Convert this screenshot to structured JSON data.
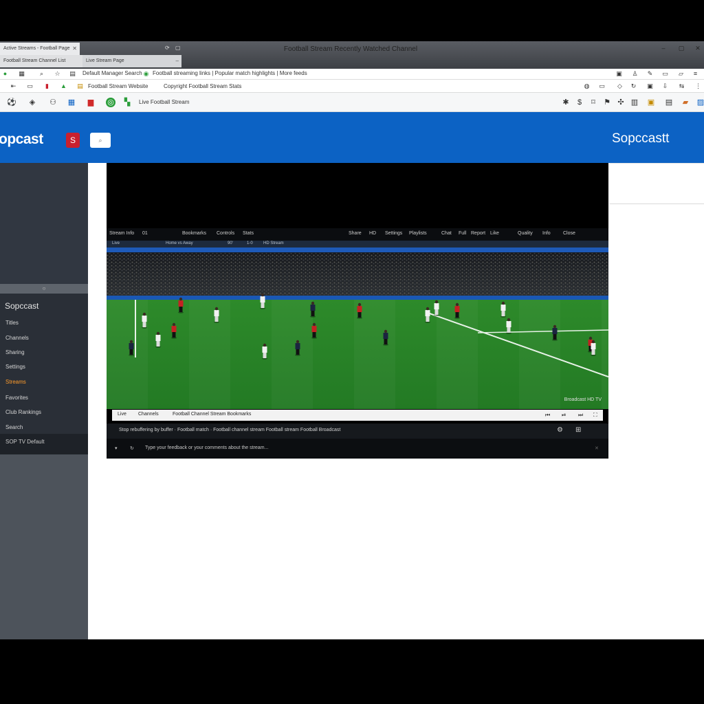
{
  "window": {
    "title": "Football Stream Recently Watched Channel",
    "tabs": [
      {
        "label": "Active Streams - Football Page"
      },
      {
        "label": "Football Stream Channel List"
      },
      {
        "label": "Live Stream Page"
      }
    ],
    "controls": {
      "minimize": "–",
      "restore": "▢",
      "close": "✕"
    }
  },
  "bookmarks": {
    "line1": "Default Manager Search",
    "line2": "Football streaming links | Popular match highlights | More feeds"
  },
  "address_bar": {
    "text1": "Football Stream Website",
    "text2": "Copyright Football Stream Stats"
  },
  "nav_bar": {
    "label": "Live Football Stream"
  },
  "site": {
    "brand_left": "opcast",
    "brand_right": "Sopccastt",
    "badge": "S",
    "search_icon": "⌕"
  },
  "sidebar": {
    "separator": "○",
    "title": "Sopccast",
    "items": [
      {
        "label": "Titles",
        "active": false
      },
      {
        "label": "Channels",
        "active": false
      },
      {
        "label": "Sharing",
        "active": false
      },
      {
        "label": "Settings",
        "active": false
      },
      {
        "label": "Streams",
        "active": true
      },
      {
        "label": "Favorites",
        "active": false
      },
      {
        "label": "Club Rankings",
        "active": false
      },
      {
        "label": "Search",
        "active": false
      }
    ],
    "footer": "SOP TV Default"
  },
  "player": {
    "toolbar_left": [
      "Stream Info",
      "01",
      "Bookmarks",
      "Controls",
      "Stats"
    ],
    "toolbar_right": [
      "Share",
      "HD",
      "Settings",
      "Playlists",
      "Chat",
      "Full",
      "Report",
      "Like",
      "Quality",
      "Info",
      "Close"
    ],
    "infobar": [
      "Live",
      "Home vs Away",
      "90'",
      "1-0",
      "HD Stream"
    ],
    "watermark": "Broadcast HD TV",
    "ctrl": {
      "left1": "Live",
      "left2": "Channels",
      "middle": "Football Channel Stream Bookmarks",
      "icons": [
        "⏮",
        "⏯",
        "⏭",
        "⛶"
      ]
    },
    "info_row": {
      "text": "Stop rebuffering by buffer · Football match · Football channel stream Football stream Football Broadcast",
      "icons": [
        "⚙",
        "⊞"
      ]
    },
    "chat": {
      "text": "Type your feedback or your comments about the stream...",
      "icons": [
        "▾",
        "↻",
        "✕"
      ]
    }
  },
  "colors": {
    "header_blue": "#0c62c4",
    "sidebar": "#2a2f37",
    "pitch_green": "#2f8a2a",
    "accent_orange": "#ff9c2b",
    "team_red": "#c42222",
    "team_white": "#f2f2f2",
    "team_navy": "#1b2440"
  }
}
